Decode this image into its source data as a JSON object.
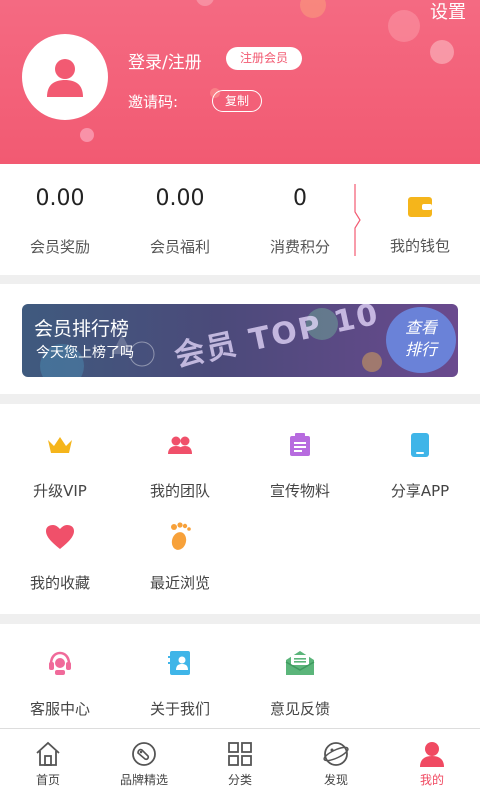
{
  "header": {
    "settings_label": "设置",
    "login_label": "登录/注册",
    "member_button": "注册会员",
    "invite_label": "邀请码:",
    "copy_button": "复制"
  },
  "stats": [
    {
      "value": "0.00",
      "label": "会员奖励"
    },
    {
      "value": "0.00",
      "label": "会员福利"
    },
    {
      "value": "0",
      "label": "消费积分"
    }
  ],
  "wallet": {
    "label": "我的钱包",
    "icon": "wallet-icon"
  },
  "banner": {
    "title": "会员排行榜",
    "subtitle": "今天您上榜了吗",
    "art_text": "会员 TOP 10",
    "button": "查看\n排行"
  },
  "features": [
    {
      "label": "升级VIP",
      "icon": "crown-icon",
      "color": "#f5b51b"
    },
    {
      "label": "我的团队",
      "icon": "team-icon",
      "color": "#f0506a"
    },
    {
      "label": "宣传物料",
      "icon": "clipboard-icon",
      "color": "#b76bdf"
    },
    {
      "label": "分享APP",
      "icon": "phone-icon",
      "color": "#3fb5e8"
    },
    {
      "label": "我的收藏",
      "icon": "heart-icon",
      "color": "#f0506a"
    },
    {
      "label": "最近浏览",
      "icon": "footprint-icon",
      "color": "#f7a13a"
    }
  ],
  "services": [
    {
      "label": "客服中心",
      "icon": "headset-icon",
      "color": "#f06a9a"
    },
    {
      "label": "关于我们",
      "icon": "contact-book-icon",
      "color": "#3fb5e8"
    },
    {
      "label": "意见反馈",
      "icon": "envelope-icon",
      "color": "#5bb57a"
    }
  ],
  "tabs": [
    {
      "label": "首页",
      "icon": "home-icon",
      "active": false
    },
    {
      "label": "品牌精选",
      "icon": "tag-icon",
      "active": false
    },
    {
      "label": "分类",
      "icon": "grid-icon",
      "active": false
    },
    {
      "label": "发现",
      "icon": "planet-icon",
      "active": false
    },
    {
      "label": "我的",
      "icon": "user-icon",
      "active": true
    }
  ],
  "colors": {
    "accent": "#f25a72",
    "active_tab": "#f04a62"
  }
}
